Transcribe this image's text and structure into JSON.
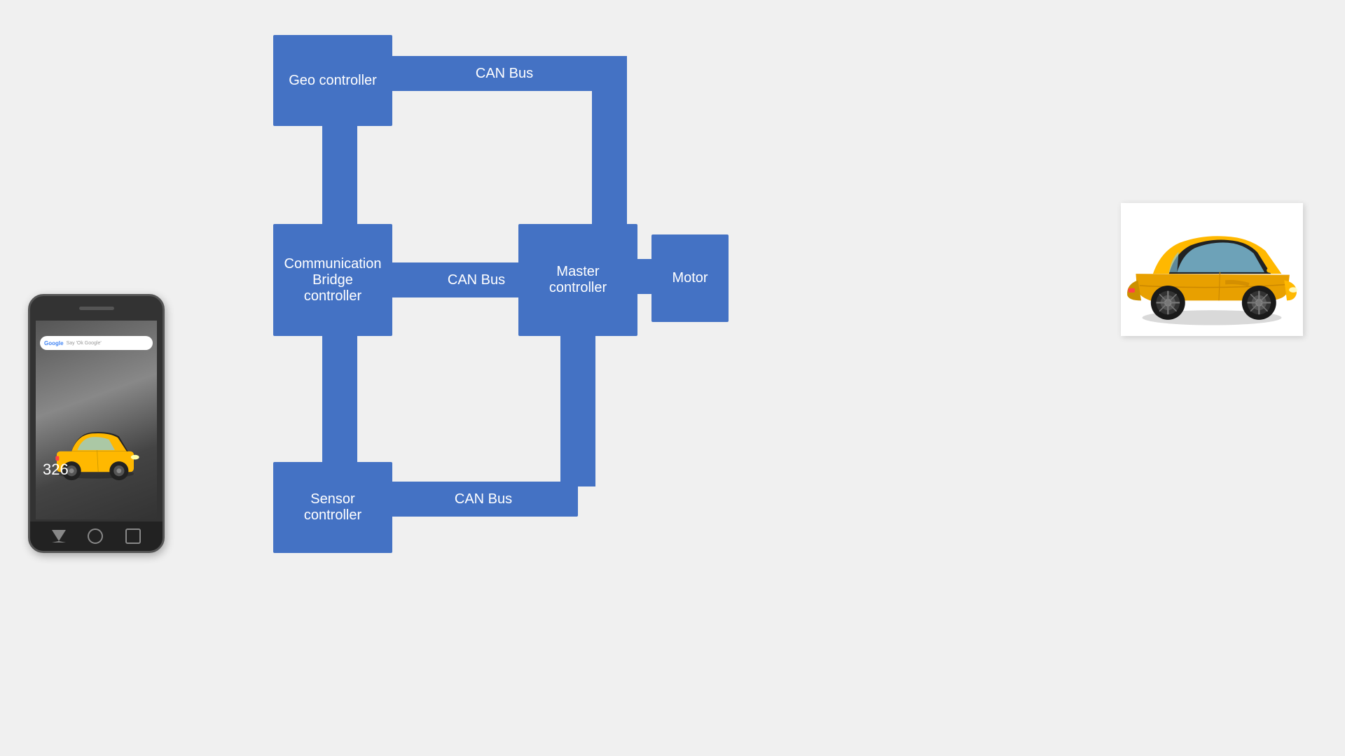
{
  "diagram": {
    "geo_controller": "Geo controller",
    "can_bus_top": "CAN Bus",
    "communication_bridge": "Communication\nBridge\ncontroller",
    "can_bus_mid": "CAN Bus",
    "master_controller": "Master\ncontroller",
    "motor": "Motor",
    "sensor_controller": "Sensor\ncontroller",
    "can_bus_bot": "CAN Bus"
  },
  "phone": {
    "clock": "326",
    "google_label": "Google",
    "search_placeholder": "Say 'Ok Google'"
  },
  "colors": {
    "blue": "#4472C4",
    "background": "#f0f0f0",
    "white": "#ffffff"
  }
}
